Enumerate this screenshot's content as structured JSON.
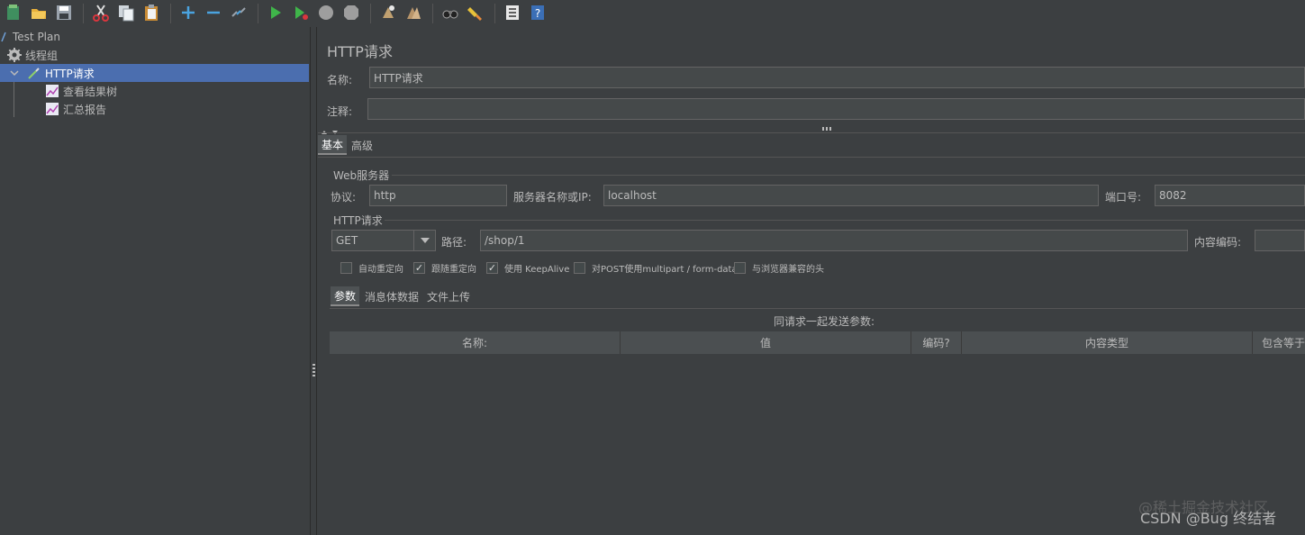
{
  "toolbar": {
    "icons": [
      "new-plan-icon",
      "open-icon",
      "save-icon",
      "cut-icon",
      "copy-icon",
      "paste-icon",
      "expand-icon",
      "collapse-icon",
      "toggle-icon",
      "start-icon",
      "start-no-pause-icon",
      "stop-icon",
      "shutdown-icon",
      "clear-icon",
      "clear-all-icon",
      "search-icon",
      "reset-search-icon",
      "function-helper-icon",
      "help-icon"
    ]
  },
  "tree": {
    "items": [
      {
        "label": "Test Plan"
      },
      {
        "label": "线程组"
      },
      {
        "label": "HTTP请求"
      },
      {
        "label": "查看结果树"
      },
      {
        "label": "汇总报告"
      }
    ]
  },
  "panel": {
    "title": "HTTP请求",
    "name_label": "名称:",
    "name_value": "HTTP请求",
    "comment_label": "注释:",
    "comment_value": "",
    "tabs": [
      {
        "label": "基本"
      },
      {
        "label": "高级"
      }
    ],
    "web_server": {
      "title": "Web服务器",
      "protocol_label": "协议:",
      "protocol_value": "http",
      "server_label": "服务器名称或IP:",
      "server_value": "localhost",
      "port_label": "端口号:",
      "port_value": "8082"
    },
    "http_request": {
      "title": "HTTP请求",
      "method_value": "GET",
      "path_label": "路径:",
      "path_value": "/shop/1",
      "encoding_label": "内容编码:",
      "encoding_value": ""
    },
    "checkboxes": [
      {
        "label": "自动重定向",
        "checked": false
      },
      {
        "label": "跟随重定向",
        "checked": true
      },
      {
        "label": "使用 KeepAlive",
        "checked": true
      },
      {
        "label": "对POST使用multipart / form-data",
        "checked": false
      },
      {
        "label": "与浏览器兼容的头",
        "checked": false
      }
    ],
    "sub_tabs": [
      {
        "label": "参数"
      },
      {
        "label": "消息体数据"
      },
      {
        "label": "文件上传"
      }
    ],
    "params_caption": "同请求一起发送参数:",
    "table_headers": [
      "名称:",
      "值",
      "编码?",
      "内容类型",
      "包含等于"
    ]
  },
  "watermark": {
    "line1": "@稀土掘金技术社区",
    "line2": "CSDN @Bug 终结者"
  }
}
